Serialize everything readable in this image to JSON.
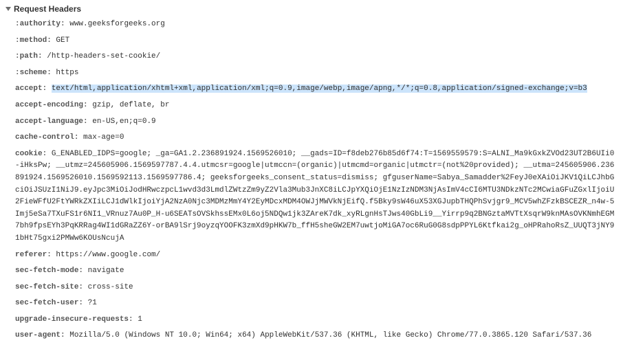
{
  "section_title": "Request Headers",
  "headers": [
    {
      "name": ":authority",
      "value": "www.geeksforgeeks.org",
      "highlighted": false
    },
    {
      "name": ":method",
      "value": "GET",
      "highlighted": false
    },
    {
      "name": ":path",
      "value": "/http-headers-set-cookie/",
      "highlighted": false
    },
    {
      "name": ":scheme",
      "value": "https",
      "highlighted": false
    },
    {
      "name": "accept",
      "value": "text/html,application/xhtml+xml,application/xml;q=0.9,image/webp,image/apng,*/*;q=0.8,application/signed-exchange;v=b3",
      "highlighted": true
    },
    {
      "name": "accept-encoding",
      "value": "gzip, deflate, br",
      "highlighted": false
    },
    {
      "name": "accept-language",
      "value": "en-US,en;q=0.9",
      "highlighted": false
    },
    {
      "name": "cache-control",
      "value": "max-age=0",
      "highlighted": false
    },
    {
      "name": "cookie",
      "value": "G_ENABLED_IDPS=google; _ga=GA1.2.236891924.1569526010; __gads=ID=f8deb276b85d6f74:T=1569559579:S=ALNI_Ma9kGxkZVOd23UT2B6UIi0-iHksPw; __utmz=245605906.1569597787.4.4.utmcsr=google|utmccn=(organic)|utmcmd=organic|utmctr=(not%20provided); __utma=245605906.236891924.1569526010.1569592113.1569597786.4; geeksforgeeks_consent_status=dismiss; gfguserName=Sabya_Samadder%2FeyJ0eXAiOiJKV1QiLCJhbGciOiJSUzI1NiJ9.eyJpc3MiOiJodHRwczpcL1wvd3d3LmdlZWtzZm9yZ2Vla3Mub3JnXC8iLCJpYXQiOjE1NzIzNDM3NjAsImV4cCI6MTU3NDkzNTc2MCwiaGFuZGxlIjoiU2FieWFfU2FtYWRkZXIiLCJ1dWlkIjoiYjA2NzA0Njc3MDMzMmY4Y2EyMDcxMDM4OWJjMWVkNjEifQ.f5Bky9sW46uX53XGJupbTHQPhSvjgr9_MCV5whZFzkBSCEZR_n4w-5Imj5eSa7TXuFS1r6NI1_VRnuz7Au0P_H-u6SEATsOVSkhssEMx0L6oj5NDQw1jk3ZAreK7dk_xyRLgnHsTJws40GbLi9__Yirrp9q2BNGztaMVTtXsqrW9knMAsOVKNmhEGM7bh9fpsEYh3PqKRRag4WI1dGRaZZ6Y-orBA9lSrj9oyzqYOOFK3zmXd9pHKW7b_ffH5sheGW2EM7uwtjoMiGA7oc6RuG0G8sdpPPYL6Ktfkai2g_oHPRahoRsZ_UUQT3jNY91bHt75gxi2PMWw6KOUsNcujA",
      "highlighted": false
    },
    {
      "name": "referer",
      "value": "https://www.google.com/",
      "highlighted": false
    },
    {
      "name": "sec-fetch-mode",
      "value": "navigate",
      "highlighted": false
    },
    {
      "name": "sec-fetch-site",
      "value": "cross-site",
      "highlighted": false
    },
    {
      "name": "sec-fetch-user",
      "value": "?1",
      "highlighted": false
    },
    {
      "name": "upgrade-insecure-requests",
      "value": "1",
      "highlighted": false
    },
    {
      "name": "user-agent",
      "value": "Mozilla/5.0 (Windows NT 10.0; Win64; x64) AppleWebKit/537.36 (KHTML, like Gecko) Chrome/77.0.3865.120 Safari/537.36",
      "highlighted": false
    }
  ]
}
